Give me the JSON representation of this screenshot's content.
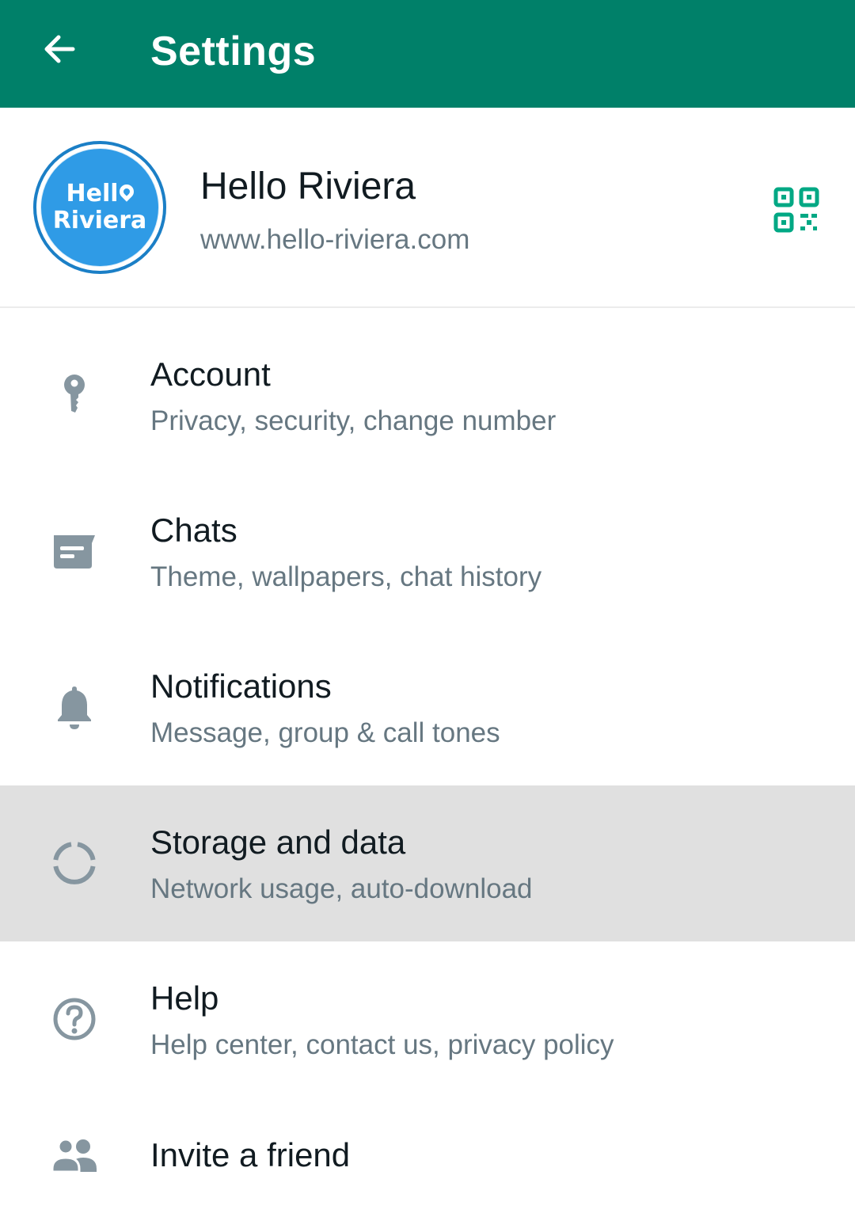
{
  "appbar": {
    "title": "Settings",
    "back_icon": "arrow-left-icon",
    "color": "#008069"
  },
  "profile": {
    "name": "Hello Riviera",
    "status": "www.hello-riviera.com",
    "avatar_line1": "Hell",
    "avatar_line2": "Riviera",
    "qr_icon": "qr-code-icon"
  },
  "menu": {
    "items": [
      {
        "title": "Account",
        "subtitle": "Privacy, security, change number",
        "icon": "key-icon"
      },
      {
        "title": "Chats",
        "subtitle": "Theme, wallpapers, chat history",
        "icon": "chat-icon"
      },
      {
        "title": "Notifications",
        "subtitle": "Message, group & call tones",
        "icon": "bell-icon"
      },
      {
        "title": "Storage and data",
        "subtitle": "Network usage, auto-download",
        "icon": "data-usage-icon",
        "highlighted": true
      },
      {
        "title": "Help",
        "subtitle": "Help center, contact us, privacy policy",
        "icon": "help-circle-icon"
      },
      {
        "title": "Invite a friend",
        "subtitle": "",
        "icon": "people-icon"
      }
    ]
  },
  "colors": {
    "accent": "#008069",
    "icon_gray": "#8696a0",
    "highlight_bg": "#e0e0e0"
  }
}
